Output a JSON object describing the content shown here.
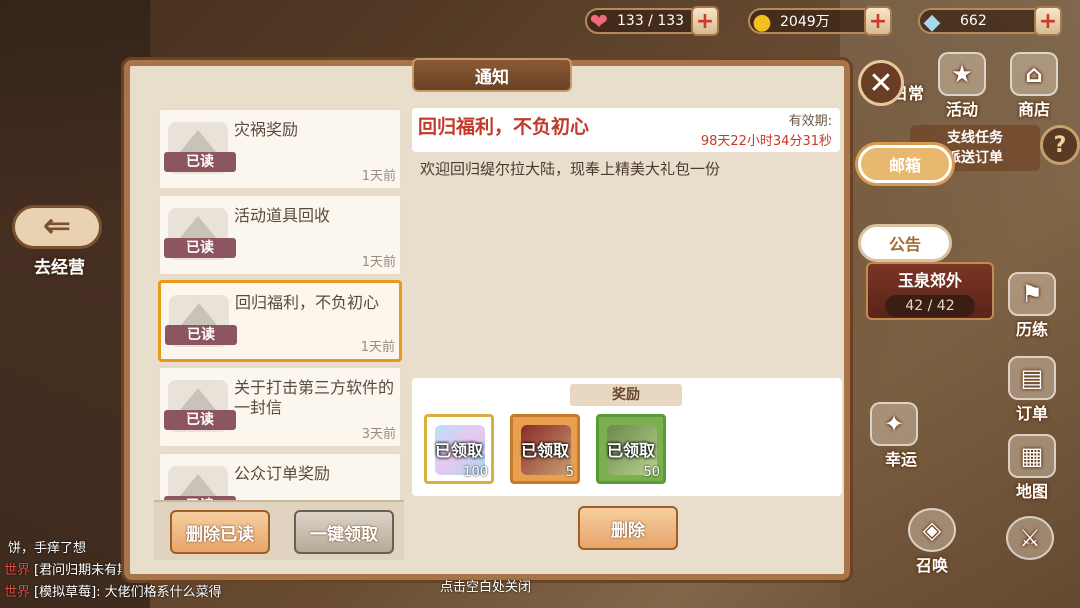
{
  "resources": {
    "stamina": "133 / 133",
    "gold": "2049万",
    "gems": "662"
  },
  "left": {
    "go_back_label": "去经营"
  },
  "chat": [
    {
      "channel": "",
      "text": "饼，手痒了想"
    },
    {
      "channel": "世界",
      "text": "[君问归期未有期]: ....."
    },
    {
      "channel": "世界",
      "text": "[模拟草莓]: 大佬们格系什么菜得"
    }
  ],
  "right_menu": {
    "daily": "日常",
    "activity": "活动",
    "shop": "商店",
    "branch_line1": "支线任务",
    "branch_line2": "派送订单",
    "help": "?",
    "mail": "邮箱",
    "notice": "公告",
    "location_name": "玉泉郊外",
    "location_count": "42 / 42",
    "training": "历练",
    "orders": "订单",
    "luck": "幸运",
    "map": "地图",
    "summon": "召唤"
  },
  "modal": {
    "title": "通知",
    "close_label": "✕",
    "mails": [
      {
        "title": "灾祸奖励",
        "status": "已读",
        "time": "1天前"
      },
      {
        "title": "活动道具回收",
        "status": "已读",
        "time": "1天前"
      },
      {
        "title": "回归福利，不负初心",
        "status": "已读",
        "time": "1天前"
      },
      {
        "title": "关于打击第三方软件的一封信",
        "status": "已读",
        "time": "3天前"
      },
      {
        "title": "公众订单奖励",
        "status": "已读",
        "time": ""
      }
    ],
    "delete_read_label": "删除已读",
    "claim_all_label": "一键领取",
    "detail": {
      "title": "回归福利，不负初心",
      "expiry_label": "有效期:",
      "expiry_time": "98天22小时34分31秒",
      "body": "欢迎回归缇尔拉大陆，现奉上精美大礼包一份"
    },
    "rewards_label": "奖励",
    "rewards": [
      {
        "status": "已领取",
        "qty": "100"
      },
      {
        "status": "已领取",
        "qty": "5"
      },
      {
        "status": "已领取",
        "qty": "50"
      }
    ],
    "delete_label": "删除"
  },
  "hint": "点击空白处关闭",
  "colors": {
    "accent_red": "#c23a2a",
    "selected_border": "#e59a1e",
    "read_badge": "#8c5560"
  }
}
